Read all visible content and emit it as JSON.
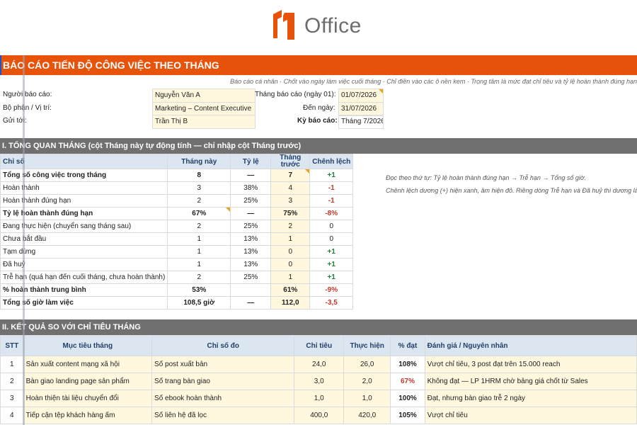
{
  "brand": {
    "name": "Office"
  },
  "report": {
    "title": "BÁO CÁO TIẾN ĐỘ CÔNG VIỆC THEO THÁNG",
    "note": "Báo cáo cá nhân · Chốt vào ngày làm việc cuối tháng · Chỉ điền vào các ô nền kem · Trọng tâm là mức đạt chỉ tiêu và tỷ lệ hoàn thành đúng hạn",
    "fields": {
      "reporter_label": "Người báo cáo:",
      "reporter": "Nguyễn Văn A",
      "dept_label": "Bộ phận / Vị trí:",
      "dept": "Marketing – Content Executive",
      "sendto_label": "Gửi tới:",
      "sendto": "Trần Thị B",
      "month_label": "Tháng báo cáo (ngày 01):",
      "month": "01/07/2026",
      "to_label": "Đến ngày:",
      "to": "31/07/2026",
      "period_label": "Kỳ báo cáo:",
      "period": "Tháng 7/2026"
    }
  },
  "section1": {
    "title": "I. TỔNG QUAN THÁNG  (cột Tháng này tự động tính — chỉ nhập cột Tháng trước)",
    "headers": [
      "Chỉ số",
      "Tháng này",
      "Tỷ lệ",
      "Tháng trước",
      "Chênh lệch"
    ],
    "rows": [
      {
        "label": "Tổng số công việc trong tháng",
        "now": "8",
        "ratio": "—",
        "prev": "7",
        "diff": "+1",
        "bold": true
      },
      {
        "label": "Hoàn thành",
        "now": "3",
        "ratio": "38%",
        "prev": "4",
        "diff": "-1"
      },
      {
        "label": "Hoàn thành đúng hạn",
        "now": "2",
        "ratio": "25%",
        "prev": "3",
        "diff": "-1"
      },
      {
        "label": "Tỷ lệ hoàn thành đúng hạn",
        "now": "67%",
        "ratio": "—",
        "prev": "75%",
        "diff": "-8%",
        "bold": true
      },
      {
        "label": "Đang thực hiện (chuyển sang tháng sau)",
        "now": "2",
        "ratio": "25%",
        "prev": "2",
        "diff": "0"
      },
      {
        "label": "Chưa bắt đầu",
        "now": "1",
        "ratio": "13%",
        "prev": "1",
        "diff": "0"
      },
      {
        "label": "Tạm dừng",
        "now": "1",
        "ratio": "13%",
        "prev": "0",
        "diff": "+1"
      },
      {
        "label": "Đã huỷ",
        "now": "1",
        "ratio": "13%",
        "prev": "0",
        "diff": "+1"
      },
      {
        "label": "Trễ hạn (quá hạn đến cuối tháng, chưa hoàn thành)",
        "now": "2",
        "ratio": "25%",
        "prev": "1",
        "diff": "+1"
      },
      {
        "label": "% hoàn thành trung bình",
        "now": "53%",
        "ratio": "",
        "prev": "61%",
        "diff": "-9%",
        "bold": true
      },
      {
        "label": "Tổng số giờ làm việc",
        "now": "108,5 giờ",
        "ratio": "—",
        "prev": "112,0",
        "diff": "-3,5",
        "bold": true
      }
    ],
    "notes": [
      "Đọc theo thứ tự: Tỷ lệ hoàn thành đúng hạn → Trễ hạn → Tổng số giờ.",
      "Chênh lệch dương (+) hiện xanh, âm hiện đỏ. Riêng dòng Trễ hạn và Đã huỷ thì dương là xấu"
    ]
  },
  "section2": {
    "title": "II. KẾT QUẢ SO VỚI CHỈ TIÊU THÁNG",
    "headers": [
      "STT",
      "Mục tiêu tháng",
      "Chỉ số đo",
      "Chỉ tiêu",
      "Thực hiện",
      "% đạt",
      "Đánh giá / Nguyên nhân"
    ],
    "rows": [
      {
        "stt": "1",
        "goal": "Sản xuất content mạng xã hội",
        "metric": "Số post xuất bản",
        "target": "24,0",
        "actual": "26,0",
        "pct": "108%",
        "eval": "Vượt chỉ tiêu, 3 post đạt trên 15.000 reach"
      },
      {
        "stt": "2",
        "goal": "Bàn giao landing page sản phẩm",
        "metric": "Số trang bàn giao",
        "target": "3,0",
        "actual": "2,0",
        "pct": "67%",
        "eval": "Không đạt — LP 1HRM chờ bảng giá chốt từ Sales",
        "low": true
      },
      {
        "stt": "3",
        "goal": "Hoàn thiện tài liệu chuyển đổi",
        "metric": "Số ebook hoàn thành",
        "target": "1,0",
        "actual": "1,0",
        "pct": "100%",
        "eval": "Đạt, nhưng bàn giao trễ 2 ngày"
      },
      {
        "stt": "4",
        "goal": "Tiếp cận tệp khách hàng ấm",
        "metric": "Số liên hệ đã lọc",
        "target": "400,0",
        "actual": "420,0",
        "pct": "105%",
        "eval": "Vượt chỉ tiêu"
      }
    ]
  },
  "colors": {
    "accent": "#e8530c",
    "section": "#707070",
    "header_bg": "#dce6f1",
    "negative": "#c0392b",
    "positive": "#1e7e34"
  }
}
